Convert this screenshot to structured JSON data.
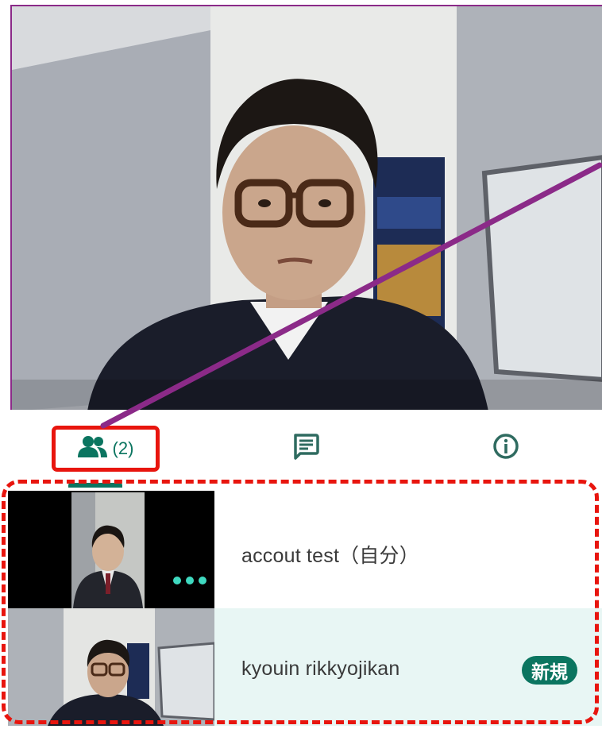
{
  "tabs": {
    "people": {
      "icon": "people-icon",
      "count_label": "(2)"
    },
    "chat": {
      "icon": "chat-icon"
    },
    "info": {
      "icon": "info-icon"
    }
  },
  "participants": [
    {
      "name": "accout test（自分）",
      "badge": ""
    },
    {
      "name": "kyouin rikkyojikan",
      "badge": "新規"
    }
  ],
  "colors": {
    "accent": "#0b7560",
    "highlight_red": "#e8150e",
    "annotation_purple": "#8b2a88",
    "selected_row": "#e8f6f4"
  }
}
